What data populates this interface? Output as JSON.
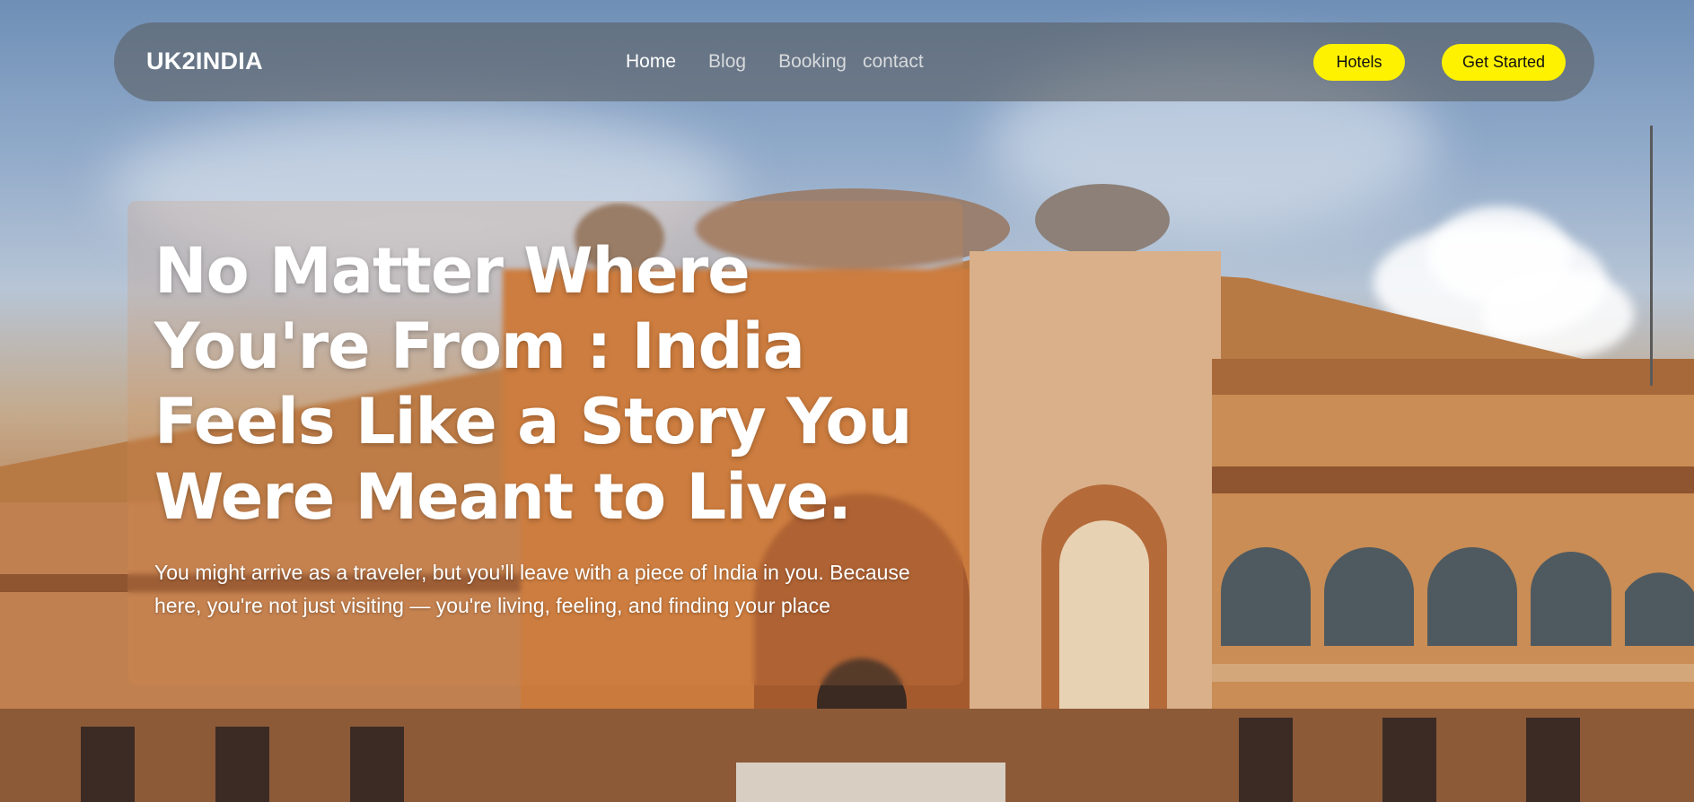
{
  "brand": {
    "name": "UK2INDIA"
  },
  "nav": {
    "links": [
      {
        "label": "Home",
        "active": true
      },
      {
        "label": "Blog",
        "active": false
      },
      {
        "label": "Booking",
        "active": false
      },
      {
        "label": "contact",
        "active": false
      }
    ],
    "hotels_label": "Hotels",
    "get_started_label": "Get Started"
  },
  "hero": {
    "headline": "No Matter Where You're From : India Feels Like a Story You Were Meant to Live.",
    "subtext": "You might arrive as a traveler, but you’ll leave with a piece of India in you. Because here, you're not just visiting — you're living, feeling, and finding your place"
  },
  "colors": {
    "accent": "#fff200",
    "nav_bg": "#5a5f64",
    "text": "#ffffff"
  }
}
